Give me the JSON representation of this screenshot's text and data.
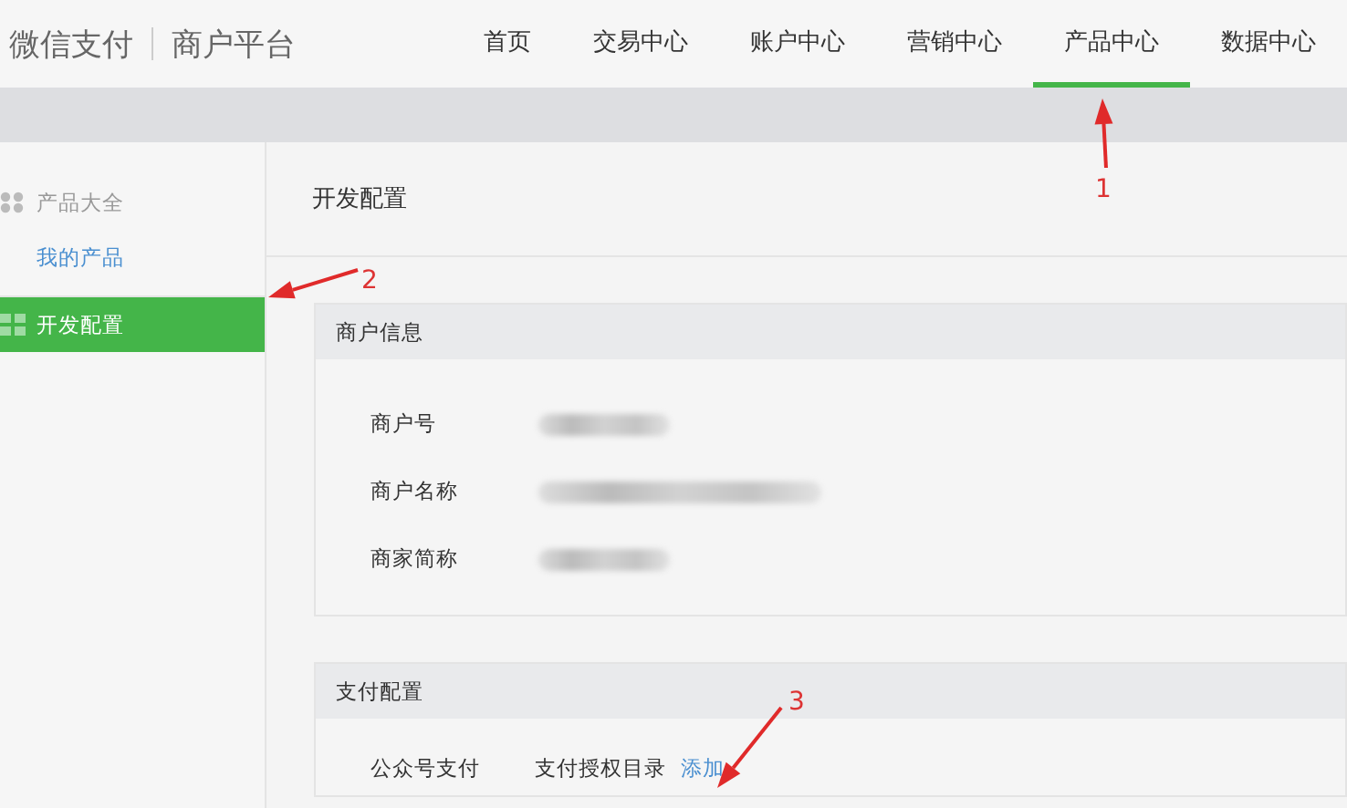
{
  "header": {
    "brand": "微信支付",
    "platform": "商户平台",
    "nav": [
      {
        "label": "首页",
        "selected": false
      },
      {
        "label": "交易中心",
        "selected": false
      },
      {
        "label": "账户中心",
        "selected": false
      },
      {
        "label": "营销中心",
        "selected": false
      },
      {
        "label": "产品中心",
        "selected": true
      },
      {
        "label": "数据中心",
        "selected": false
      }
    ]
  },
  "sidebar": {
    "items": [
      {
        "label": "产品大全",
        "kind": "heading",
        "selected": false
      },
      {
        "label": "我的产品",
        "kind": "link",
        "selected": false
      },
      {
        "label": "开发配置",
        "kind": "heading",
        "selected": true
      }
    ]
  },
  "main": {
    "title": "开发配置",
    "sections": [
      {
        "title": "商户信息",
        "fields": [
          {
            "label": "商户号"
          },
          {
            "label": "商户名称"
          },
          {
            "label": "商家简称"
          }
        ]
      },
      {
        "title": "支付配置",
        "rows": [
          {
            "label": "公众号支付",
            "item": "支付授权目录",
            "action": "添加"
          }
        ]
      }
    ]
  },
  "annotations": [
    {
      "label": "1"
    },
    {
      "label": "2"
    },
    {
      "label": "3"
    }
  ]
}
